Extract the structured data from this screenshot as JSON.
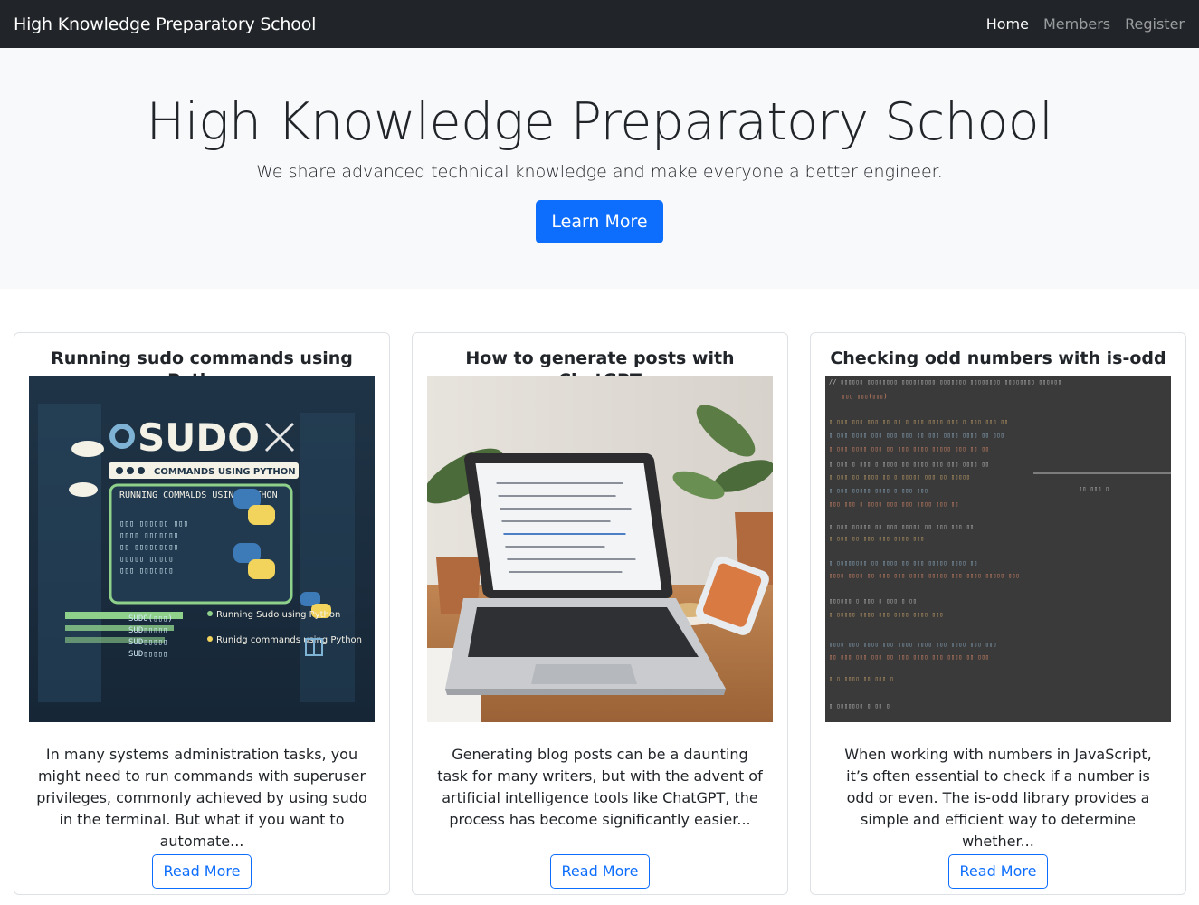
{
  "navbar": {
    "brand": "High Knowledge Preparatory School",
    "links": [
      {
        "label": "Home",
        "active": true
      },
      {
        "label": "Members",
        "active": false
      },
      {
        "label": "Register",
        "active": false
      }
    ]
  },
  "hero": {
    "title": "High Knowledge Preparatory School",
    "subtitle": "We share advanced technical knowledge and make everyone a better engineer.",
    "button_label": "Learn More"
  },
  "cards": [
    {
      "title": "Running sudo commands using Python",
      "text": "In many systems administration tasks, you might need to run commands with superuser privileges, commonly achieved by using sudo in the terminal. But what if you want to automate...",
      "button_label": "Read More",
      "image": {
        "kind": "illustration",
        "logo": "SUDO",
        "banner": "COMMANDS USING PYTHON",
        "heading": "RUNNING COMMALDS USING PYTHON",
        "items": [
          "Running Sudo using Python",
          "Runidg commands using Python"
        ]
      }
    },
    {
      "title": "How to generate posts with ChatGPT",
      "text": "Generating blog posts can be a daunting task for many writers, but with the advent of artificial intelligence tools like ChatGPT, the process has become significantly easier...",
      "button_label": "Read More",
      "image": {
        "kind": "photo",
        "subject": "laptop-on-desk"
      }
    },
    {
      "title": "Checking odd numbers with is-odd",
      "text": "When working with numbers in JavaScript, it’s often essential to check if a number is odd or even. The is-odd library provides a simple and efficient way to determine whether...",
      "button_label": "Read More",
      "image": {
        "kind": "photo",
        "subject": "code-screen"
      }
    }
  ],
  "colors": {
    "navbar_bg": "#212529",
    "hero_bg": "#f8f9fa",
    "primary": "#0d6efd",
    "card_border": "#dee2e6"
  }
}
